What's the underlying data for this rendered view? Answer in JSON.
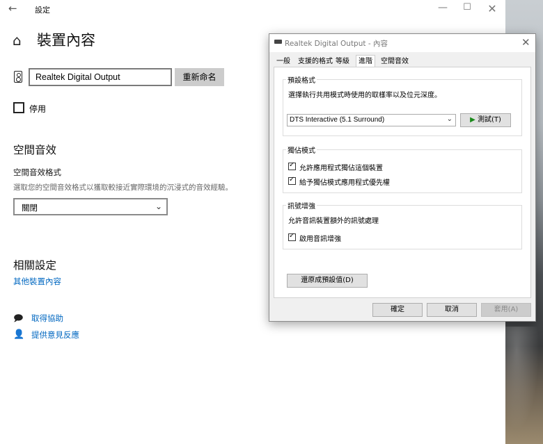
{
  "settings": {
    "app_title": "設定",
    "page_title": "裝置內容",
    "device_name_value": "Realtek Digital Output",
    "rename_label": "重新命名",
    "disable_label": "停用",
    "spatial_heading": "空間音效",
    "spatial_format_label": "空間音效格式",
    "spatial_desc": "選取您的空間音效格式以獲取較接近實際環境的沉浸式的音效經驗。",
    "spatial_selected": "關閉",
    "related_heading": "相關設定",
    "other_properties_link": "其他裝置內容",
    "help_link": "取得協助",
    "feedback_link": "提供意見反應"
  },
  "dialog": {
    "title": "Realtek Digital Output - 內容",
    "tabs": [
      "一般",
      "支援的格式",
      "等級",
      "進階",
      "空間音效"
    ],
    "active_tab": "進階",
    "default_format": {
      "group_title": "預設格式",
      "description": "選擇執行共用模式時使用的取樣率以及位元深度。",
      "selected_format": "DTS Interactive (5.1 Surround)",
      "test_label": "測試(T)"
    },
    "exclusive_mode": {
      "group_title": "獨佔模式",
      "option1": "允許應用程式獨佔這個裝置",
      "option2": "給予獨佔模式應用程式優先權",
      "option1_checked": true,
      "option2_checked": true
    },
    "signal_enhancement": {
      "group_title": "訊號增強",
      "description": "允許音訊裝置額外的訊號處理",
      "option": "啟用音訊增強",
      "option_checked": true
    },
    "restore_label": "還原成預設值(D)",
    "ok_label": "確定",
    "cancel_label": "取消",
    "apply_label": "套用(A)"
  }
}
